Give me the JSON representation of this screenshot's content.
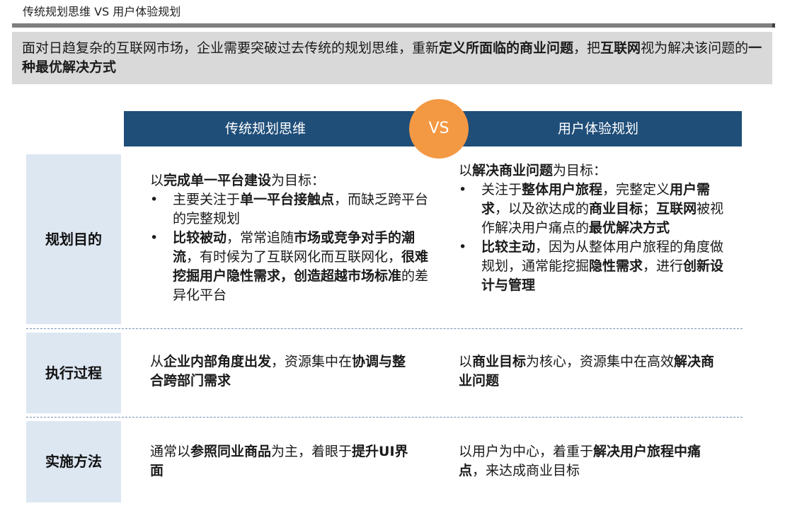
{
  "page_title": "传统规划思维 VS 用户体验规划",
  "intro": [
    {
      "t": "面对日趋复杂的互联网市场，企业需要突破过去传统的规划思维，重新",
      "b": false
    },
    {
      "t": "定义所面临的商业问题",
      "b": true
    },
    {
      "t": "，把",
      "b": false
    },
    {
      "t": "互联网",
      "b": true
    },
    {
      "t": "视为解决该问题的",
      "b": false
    },
    {
      "t": "一种最优解决方式",
      "b": true
    }
  ],
  "header": {
    "left": "传统规划思维",
    "vs": "VS",
    "right": "用户体验规划"
  },
  "rows": {
    "goal": {
      "label": "规划目的",
      "traditional": {
        "lead": [
          {
            "t": "以",
            "b": false
          },
          {
            "t": "完成单一平台建设",
            "b": true
          },
          {
            "t": "为目标：",
            "b": false
          }
        ],
        "bullets": [
          [
            {
              "t": "主要关注于",
              "b": false
            },
            {
              "t": "单一平台接触点",
              "b": true
            },
            {
              "t": "，而缺乏跨平台的完整规划",
              "b": false
            }
          ],
          [
            {
              "t": "比较被动",
              "b": true
            },
            {
              "t": "，常常追随",
              "b": false
            },
            {
              "t": "市场或竞争对手的潮流",
              "b": true
            },
            {
              "t": "，有时候为了互联网化而互联网化，",
              "b": false
            },
            {
              "t": "很难挖掘用户隐性需求，创造超越市场标准",
              "b": true
            },
            {
              "t": "的差异化平台",
              "b": false
            }
          ]
        ]
      },
      "ux": {
        "lead": [
          {
            "t": "以",
            "b": false
          },
          {
            "t": "解决商业问题",
            "b": true
          },
          {
            "t": "为目标：",
            "b": false
          }
        ],
        "bullets": [
          [
            {
              "t": "关注于",
              "b": false
            },
            {
              "t": "整体用户旅程",
              "b": true
            },
            {
              "t": "，完整定义",
              "b": false
            },
            {
              "t": "用户需求",
              "b": true
            },
            {
              "t": "，以及欲达成的",
              "b": false
            },
            {
              "t": "商业目标",
              "b": true
            },
            {
              "t": "；",
              "b": false
            },
            {
              "t": "互联网",
              "b": true
            },
            {
              "t": "被视作解决用户痛点的",
              "b": false
            },
            {
              "t": "最优解决方式",
              "b": true
            }
          ],
          [
            {
              "t": "比较主动",
              "b": true
            },
            {
              "t": "，因为从整体用户旅程的角度做规划，通常能挖掘",
              "b": false
            },
            {
              "t": "隐性需求",
              "b": true
            },
            {
              "t": "，进行",
              "b": false
            },
            {
              "t": "创新设计与管理",
              "b": true
            }
          ]
        ]
      }
    },
    "execution": {
      "label": "执行过程",
      "traditional": [
        {
          "t": "从",
          "b": false
        },
        {
          "t": "企业内部角度出发",
          "b": true
        },
        {
          "t": "，资源集中在",
          "b": false
        },
        {
          "t": "协调与整合跨部门需求",
          "b": true
        }
      ],
      "ux": [
        {
          "t": "以",
          "b": false
        },
        {
          "t": "商业目标",
          "b": true
        },
        {
          "t": "为核心，资源集中在高效",
          "b": false
        },
        {
          "t": "解决商业问题",
          "b": true
        }
      ]
    },
    "method": {
      "label": "实施方法",
      "traditional": [
        {
          "t": "通常以",
          "b": false
        },
        {
          "t": "参照同业商品",
          "b": true
        },
        {
          "t": "为主，着眼于",
          "b": false
        },
        {
          "t": "提升UI界面",
          "b": true
        }
      ],
      "ux": [
        {
          "t": "以用户为中心，着重于",
          "b": false
        },
        {
          "t": "解决用户旅程中痛点",
          "b": true
        },
        {
          "t": "，来达成商业目标",
          "b": false
        }
      ]
    }
  },
  "bullet_char": "•",
  "colors": {
    "header_bg": "#1f4e79",
    "vs_circle": "#f39843",
    "label_bg": "#dde7f2",
    "intro_bg": "#d9d9d9",
    "title_rule": "#7f7f7f"
  }
}
